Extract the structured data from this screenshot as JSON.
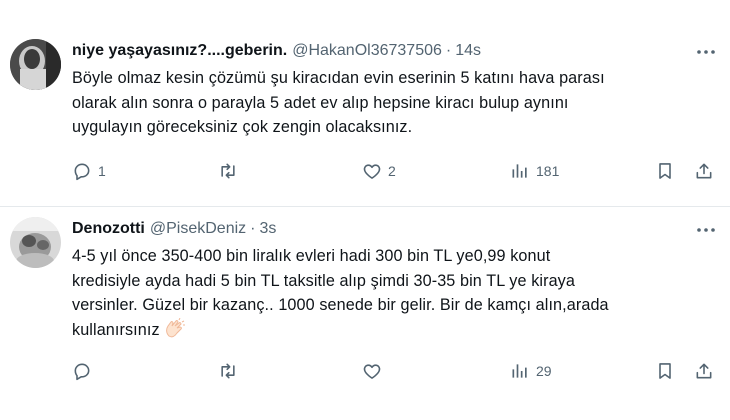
{
  "tweets": [
    {
      "name": "niye yaşayasınız?....geberin.",
      "handle": "@HakanOl36737506",
      "separator": "·",
      "time": "14s",
      "text_lines": [
        "Böyle olmaz kesin çözümü şu kiracıdan evin eserinin 5 katını hava parası",
        "olarak alın sonra o parayla 5 adet ev alıp hepsine kiracı bulup aynını",
        "uygulayın göreceksiniz çok zengin olacaksınız."
      ],
      "replies": "1",
      "reposts": "",
      "likes": "2",
      "views": "181"
    },
    {
      "name": "Denozotti",
      "handle": "@PisekDeniz",
      "separator": "·",
      "time": "3s",
      "text_lines": [
        "4-5 yıl önce 350-400 bin liralık evleri hadi 300 bin TL ye0,99 konut",
        "kredisiyle ayda hadi 5 bin TL taksitle alıp şimdi 30-35 bin TL ye kiraya",
        "versinler. Güzel bir kazanç.. 1000 senede bir gelir. Bir de kamçı alın,arada",
        "kullanırsınız"
      ],
      "replies": "",
      "reposts": "",
      "likes": "",
      "views": "29"
    }
  ],
  "icons": {
    "more": "more-horizontal-icon",
    "reply": "reply-bubble-icon",
    "repost": "repost-arrows-icon",
    "like": "heart-icon",
    "views": "bar-chart-icon",
    "bookmark": "bookmark-icon",
    "share": "share-upload-icon",
    "emoji": "clapping-hands-icon"
  },
  "colors": {
    "text": "#0f1419",
    "secondary": "#536471",
    "divider": "#e5e9ec"
  }
}
